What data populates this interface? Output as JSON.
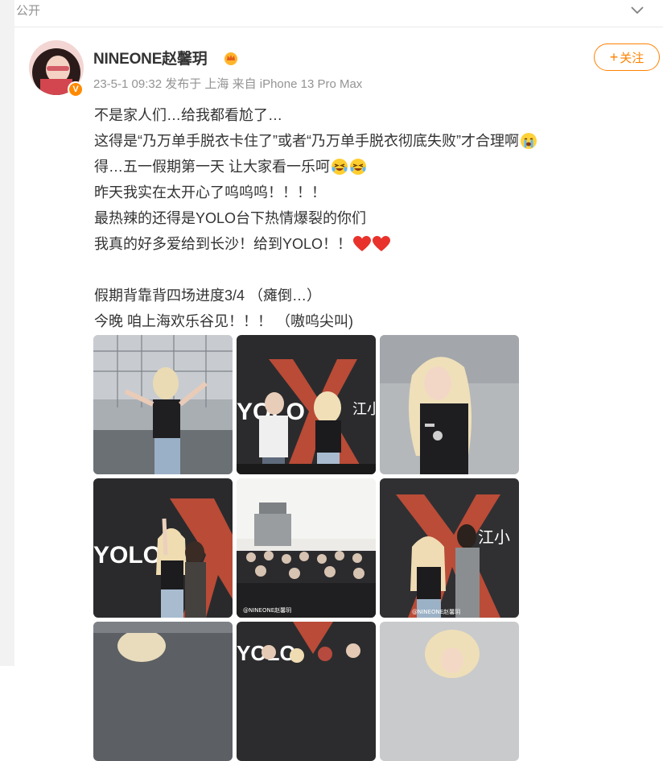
{
  "header": {
    "privacy_label": "公开"
  },
  "user": {
    "name": "NINEONE赵馨玥",
    "verified_badge": "V",
    "meta": "23-5-1 09:32 发布于 上海 来自 iPhone 13 Pro Max"
  },
  "follow_button": {
    "label": "关注",
    "plus": "+"
  },
  "post": {
    "lines": [
      "不是家人们…给我都看尬了…",
      "这得是“乃万单手脱衣卡住了”或者“乃万单手脱衣彻底失败”才合理啊",
      "得…五一假期第一天 让大家看一乐呵",
      "昨天我实在太开心了呜呜呜！！！！",
      "最热辣的还得是YOLO台下热情爆裂的你们",
      "我真的好多爱给到长沙！给到YOLO！！",
      "",
      "假期背靠背四场进度3/4 （瘫倒…）",
      "今晚 咱上海欢乐谷见！！！ （嗷呜尖叫)"
    ]
  },
  "images": {
    "watermark": "@NINEONE赵馨玥",
    "stage_brand": "YOLO",
    "sign_text": "江小",
    "count_visible": 9
  },
  "colors": {
    "accent": "#ff8200",
    "meta_text": "#939393",
    "body_text": "#333333",
    "stage_x": "#d2513a"
  },
  "icons": [
    "chevron-down-icon",
    "crown-icon",
    "verified-badge-icon",
    "cry-emoji-icon",
    "laugh-cry-emoji-icon",
    "heart-emoji-icon"
  ]
}
